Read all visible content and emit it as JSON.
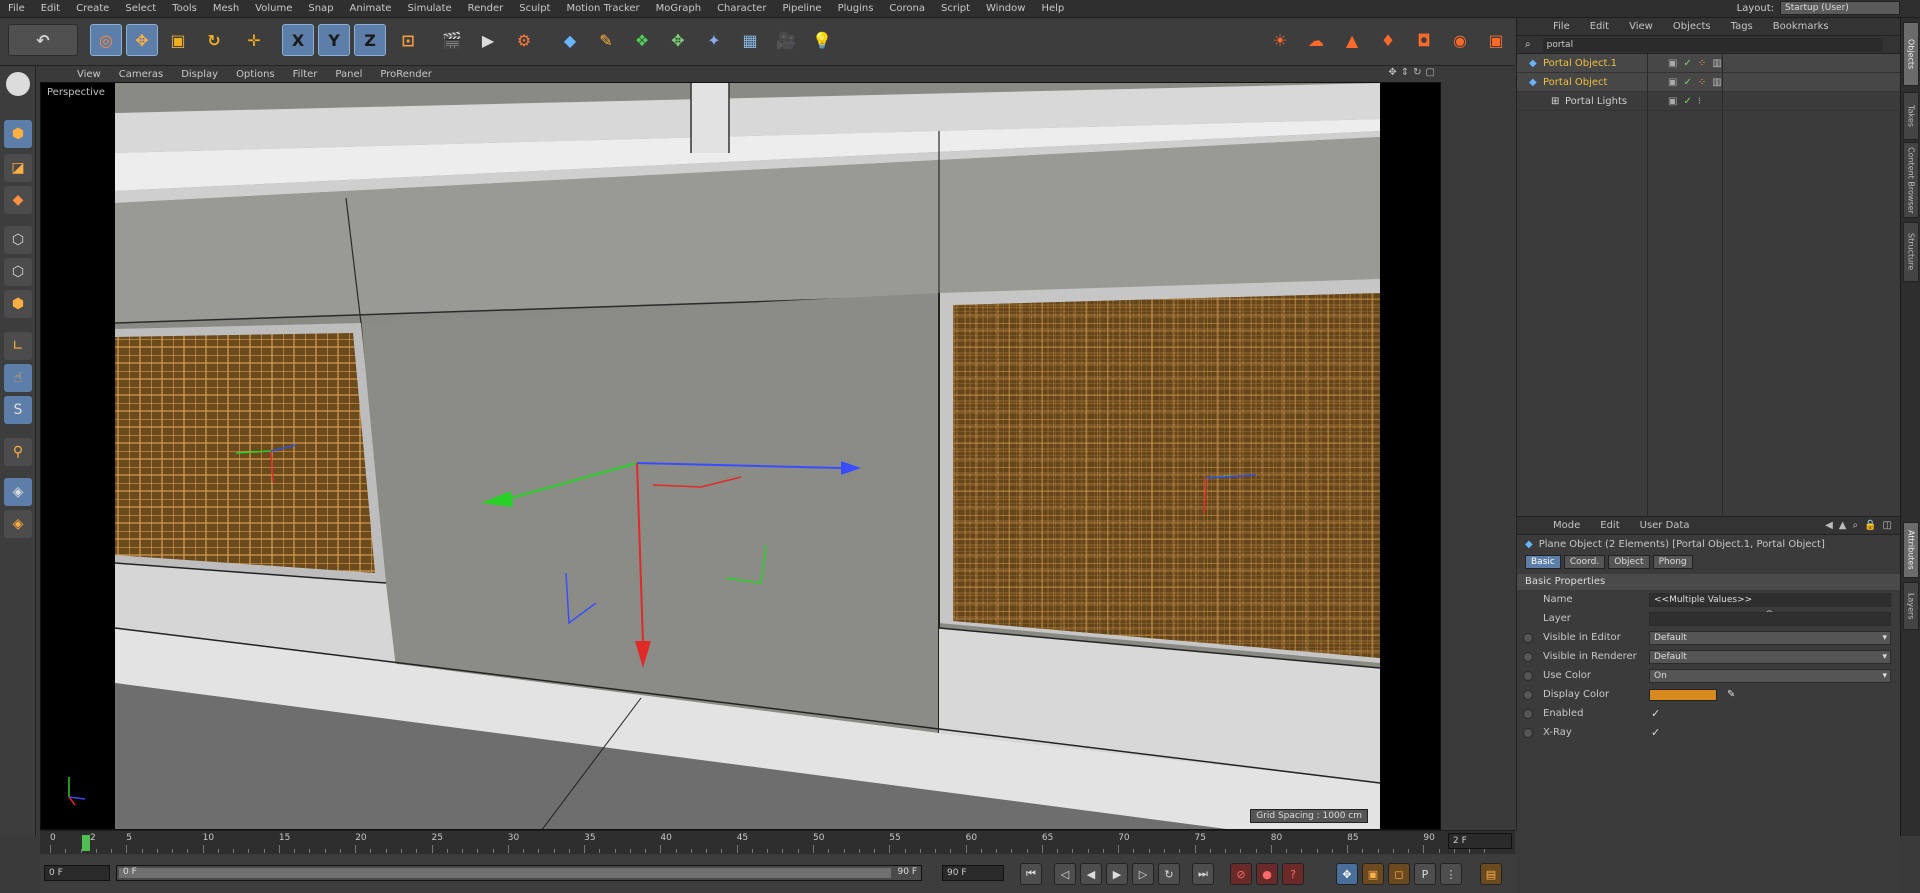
{
  "menubar": {
    "items": [
      "File",
      "Edit",
      "Create",
      "Select",
      "Tools",
      "Mesh",
      "Volume",
      "Snap",
      "Animate",
      "Simulate",
      "Render",
      "Sculpt",
      "Motion Tracker",
      "MoGraph",
      "Character",
      "Pipeline",
      "Plugins",
      "Corona",
      "Script",
      "Window",
      "Help"
    ],
    "layout_label": "Layout:",
    "layout_value": "Startup (User)"
  },
  "toolbar": {
    "axis_buttons": [
      "X",
      "Y",
      "Z"
    ]
  },
  "viewport": {
    "menu": [
      "View",
      "Cameras",
      "Display",
      "Options",
      "Filter",
      "Panel",
      "ProRender"
    ],
    "label": "Perspective",
    "grid_spacing": "Grid Spacing : 1000 cm"
  },
  "object_manager": {
    "menu": [
      "File",
      "Edit",
      "View",
      "Objects",
      "Tags",
      "Bookmarks"
    ],
    "search": "portal",
    "objects": [
      {
        "name": "Portal Object.1",
        "highlight": true
      },
      {
        "name": "Portal Object",
        "highlight": true
      },
      {
        "name": "Portal Lights",
        "highlight": false
      }
    ]
  },
  "attribute_manager": {
    "menu": [
      "Mode",
      "Edit",
      "User Data"
    ],
    "title": "Plane Object (2 Elements) [Portal Object.1, Portal Object]",
    "tabs": [
      "Basic",
      "Coord.",
      "Object",
      "Phong"
    ],
    "section": "Basic Properties",
    "rows": [
      {
        "label": "Name",
        "value": "<<Multiple Values>>"
      },
      {
        "label": "Layer",
        "value": ""
      },
      {
        "label": "Visible in Editor",
        "value": "Default"
      },
      {
        "label": "Visible in Renderer",
        "value": "Default"
      },
      {
        "label": "Use Color",
        "value": "On"
      },
      {
        "label": "Display Color",
        "value": ""
      },
      {
        "label": "Enabled",
        "value": "✓"
      },
      {
        "label": "X-Ray",
        "value": "✓"
      }
    ],
    "display_color": "#d88a1f"
  },
  "right_tabs": [
    "Objects",
    "Takes",
    "Content Browser",
    "Structure",
    "Attributes",
    "Layers"
  ],
  "timeline": {
    "ticks": [
      "0",
      "5",
      "10",
      "15",
      "20",
      "25",
      "30",
      "35",
      "40",
      "45",
      "50",
      "55",
      "60",
      "65",
      "70",
      "75",
      "80",
      "85",
      "90"
    ],
    "current_frame_marker": "2",
    "end_frame": "2 F"
  },
  "transport": {
    "start_field": "0 F",
    "range_start": "0 F",
    "range_end": "90 F",
    "end_field": "90 F"
  }
}
